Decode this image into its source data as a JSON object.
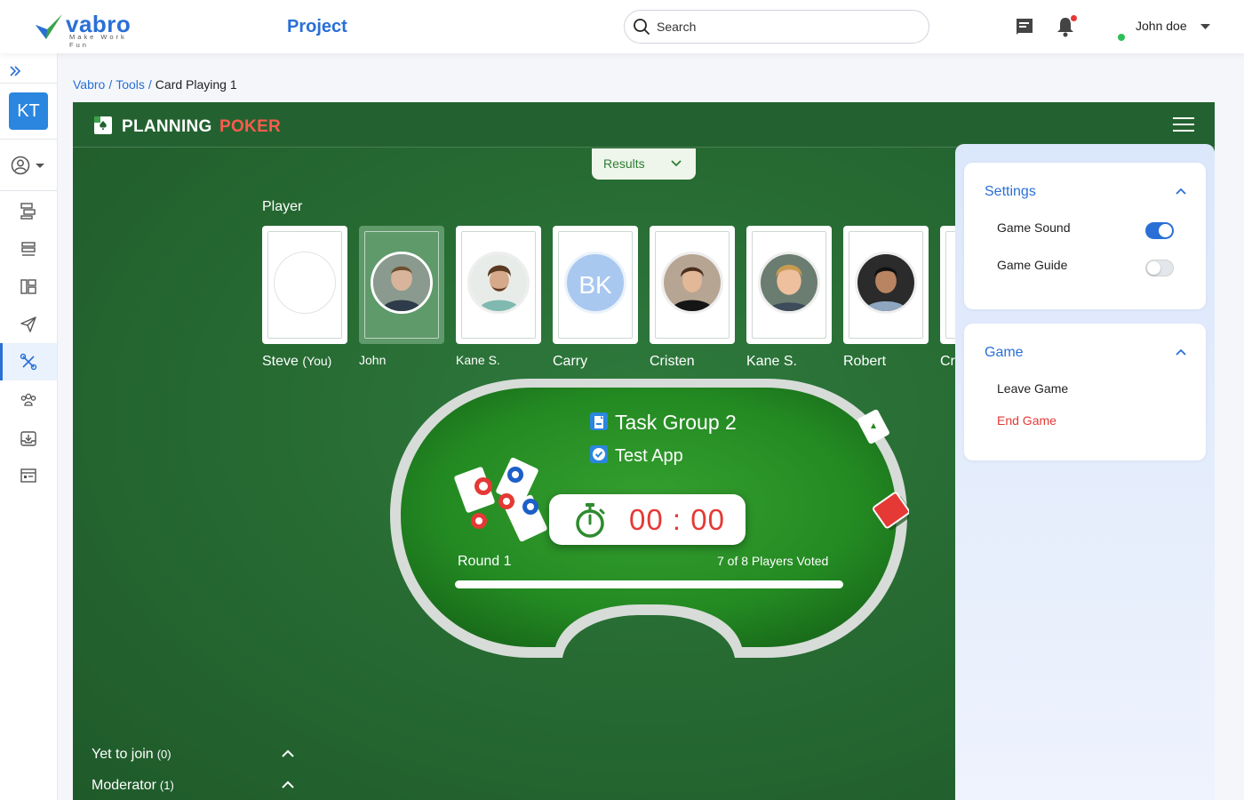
{
  "brand": {
    "name": "vabro",
    "tagline": "Make Work Fun"
  },
  "header": {
    "project_title": "Project",
    "search_placeholder": "Search",
    "user_name": "John doe"
  },
  "sidebar": {
    "avatar_initials": "KT",
    "items": [
      "backlog-icon",
      "list-icon",
      "board-icon",
      "send-icon",
      "tools-icon",
      "team-icon",
      "archive-icon",
      "report-icon"
    ],
    "active_item": "tools-icon"
  },
  "breadcrumb": {
    "items": [
      "Vabro",
      "Tools"
    ],
    "current": "Card Playing 1"
  },
  "game": {
    "title_part1": "PLANNING",
    "title_part2": "POKER",
    "results_label": "Results",
    "player_heading": "Player",
    "players": [
      {
        "name": "Steve",
        "suffix": "(You)",
        "initials": ""
      },
      {
        "name": "John",
        "suffix": "",
        "initials": ""
      },
      {
        "name": "Kane S.",
        "suffix": "",
        "initials": ""
      },
      {
        "name": "Carry",
        "suffix": "",
        "initials": "BK"
      },
      {
        "name": "Cristen",
        "suffix": "",
        "initials": ""
      },
      {
        "name": "Kane S.",
        "suffix": "",
        "initials": ""
      },
      {
        "name": "Robert",
        "suffix": "",
        "initials": ""
      },
      {
        "name": "Cr",
        "suffix": "",
        "initials": ""
      }
    ],
    "task_group": "Task Group 2",
    "task_app": "Test App",
    "timer": "00 : 00",
    "round": "Round 1",
    "voted": "7 of 8 Players Voted",
    "progress_fraction": 1.0,
    "yet_to_join_label": "Yet to join",
    "yet_to_join_count": "(0)",
    "moderator_label": "Moderator",
    "moderator_count": "(1)"
  },
  "settings": {
    "title": "Settings",
    "game_sound_label": "Game Sound",
    "game_sound_on": true,
    "game_guide_label": "Game Guide",
    "game_guide_on": false
  },
  "game_menu": {
    "title": "Game",
    "leave_label": "Leave Game",
    "end_label": "End Game"
  },
  "colors": {
    "brand_blue": "#2a6fd6",
    "felt_green": "#276b33",
    "danger_red": "#e53935",
    "poker_red": "#ff5a4e"
  }
}
